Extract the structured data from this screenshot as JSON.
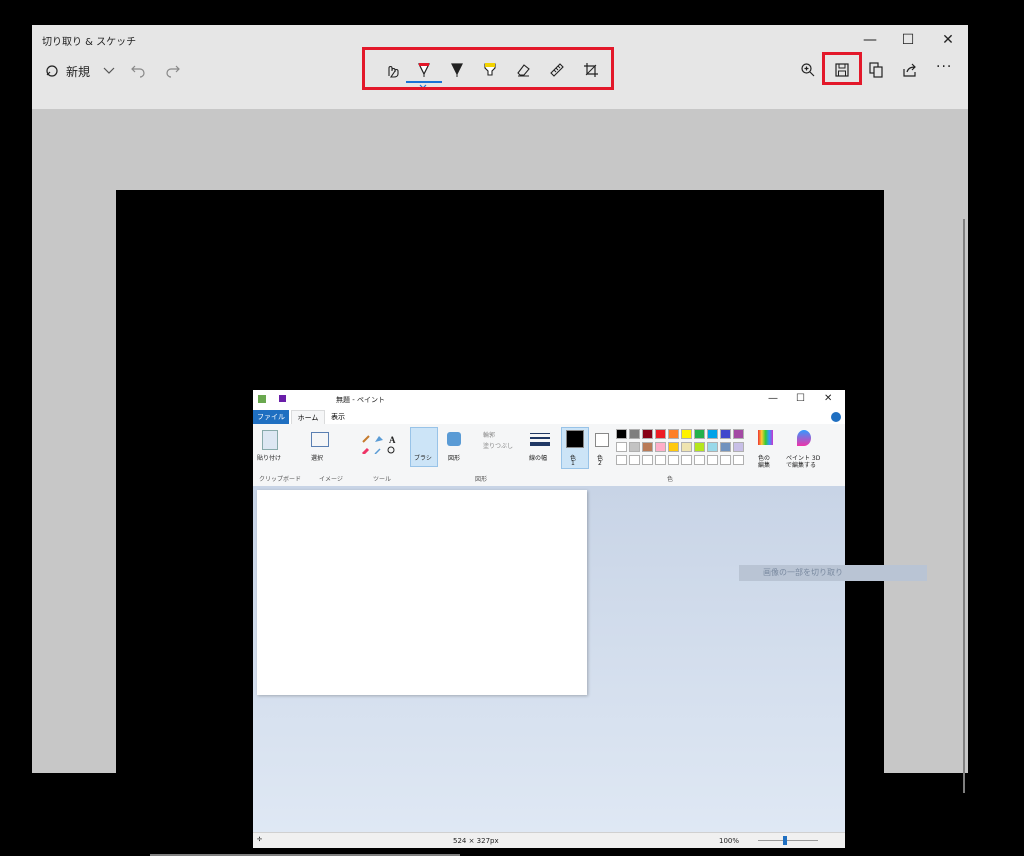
{
  "window": {
    "title": "切り取り & スケッチ",
    "minimize": "—",
    "maximize": "☐",
    "close": "✕"
  },
  "toolbar": {
    "new_label": "新規",
    "new_icon": "new-snip-icon",
    "tools": [
      "touch-writing-icon",
      "ballpoint-pen-icon",
      "pencil-icon",
      "highlighter-icon",
      "eraser-icon",
      "ruler-icon",
      "crop-icon"
    ],
    "right_tools": [
      "zoom-in-icon",
      "save-icon",
      "copy-icon",
      "share-icon",
      "more-icon"
    ],
    "more_label": "···",
    "colors": {
      "highlight_box": "#e3182a",
      "pen_red": "#e3182a",
      "highlighter_yellow": "#f2d200"
    }
  },
  "paint": {
    "title": "無題 - ペイント",
    "tabs": [
      "ファイル",
      "ホーム",
      "表示"
    ],
    "groups": {
      "clipboard": {
        "paste": "貼り付け",
        "label": "クリップボード"
      },
      "image": {
        "select": "選択",
        "label": "イメージ"
      },
      "tools": {
        "label": "ツール"
      },
      "brush": {
        "label": "ブラシ"
      },
      "shapes": {
        "shape": "図形",
        "outline": "輪郭",
        "fill": "塗りつぶし",
        "label": "図形"
      },
      "size": {
        "label": "線の幅"
      },
      "color1": {
        "label": "色",
        "num": "1"
      },
      "color2": {
        "label": "色",
        "num": "2"
      },
      "edit_colors": {
        "label1": "色の",
        "label2": "編集"
      },
      "paint3d": {
        "label1": "ペイント 3D",
        "label2": "で編集する"
      },
      "colors_label": "色"
    },
    "palette_row1": [
      "#000000",
      "#7f7f7f",
      "#880015",
      "#ed1c24",
      "#ff7f27",
      "#fff200",
      "#22b14c",
      "#00a2e8",
      "#3f48cc",
      "#a349a4"
    ],
    "palette_row2": [
      "#ffffff",
      "#c3c3c3",
      "#b97a57",
      "#ffaec9",
      "#ffc90e",
      "#efe4b0",
      "#b5e61d",
      "#99d9ea",
      "#7092be",
      "#c8bfe7"
    ],
    "status": {
      "size": "524 × 327px",
      "zoom": "100%"
    }
  },
  "overlay": {
    "tooltip": "画像の一部を切り取り"
  }
}
